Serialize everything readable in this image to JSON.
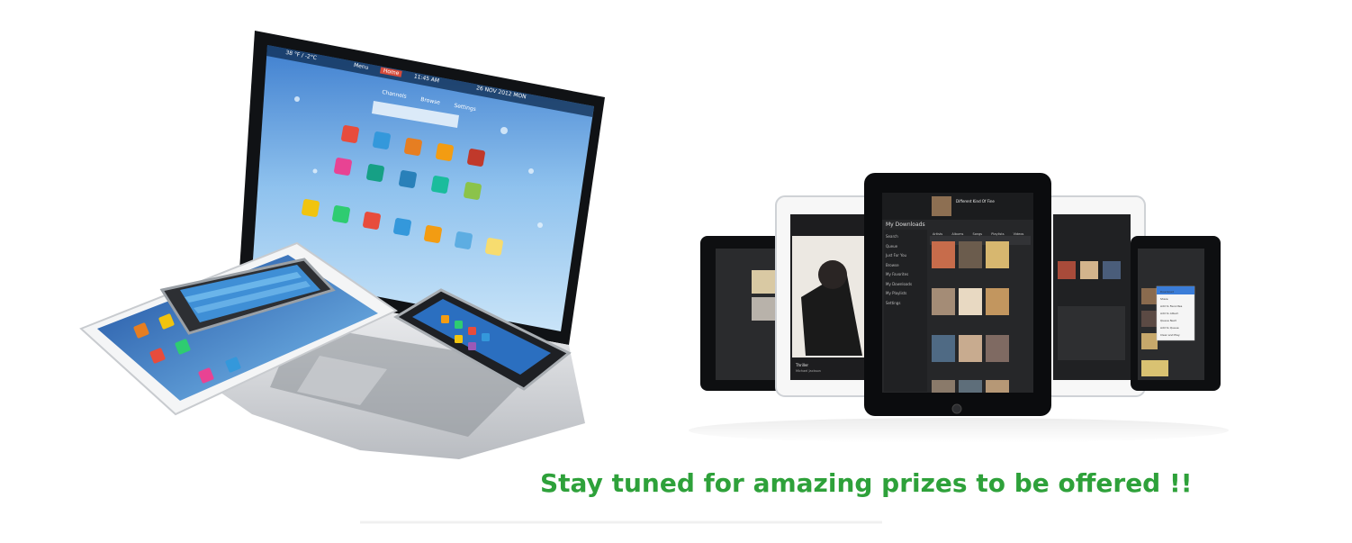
{
  "tagline": "Stay tuned for amazing prizes to be offered !!",
  "laptop_screen": {
    "status": "38 °F / -2°C",
    "menu": "Menu",
    "home": "Home",
    "channels": "Channels",
    "browse": "Browse",
    "settings": "Settings",
    "clock": "11:45 AM",
    "date": "26 NOV 2012 MON"
  },
  "music_tablet": {
    "now_playing": "Different Kind Of Fine",
    "section_title": "My Downloads",
    "sidebar": [
      "Search",
      "Queue",
      "Just For You",
      "Browse",
      "My Favorites",
      "My Downloads",
      "My Playlists",
      "Settings"
    ],
    "tabs": [
      "Artists",
      "Albums",
      "Songs",
      "Playlists",
      "Videos"
    ]
  },
  "left_tablet": {
    "album_title": "Thriller",
    "artist": "Michael Jackson"
  },
  "context_menu": {
    "items": [
      "Download",
      "Share",
      "Add to Favorites",
      "Add to Album",
      "Queue Next",
      "Add to Queue",
      "Clear and Play"
    ]
  },
  "colors": {
    "tagline": "#2ea13a",
    "laptop_sky": "#7fb6e8",
    "music_dark": "#2b2b2b",
    "device_black": "#111111",
    "device_silver": "#d9dbde"
  }
}
